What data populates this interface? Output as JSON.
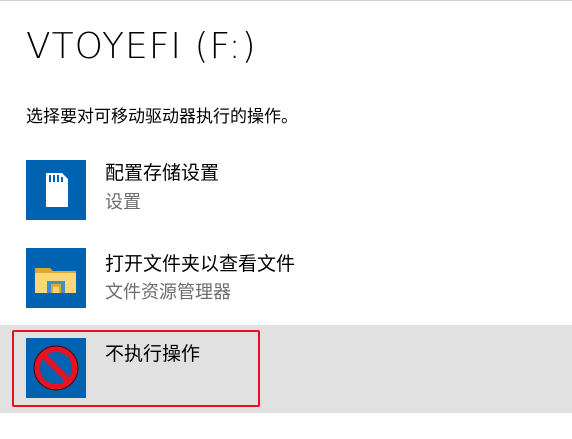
{
  "dialog": {
    "drive_title": "VTOYEFI (F:)",
    "prompt": "选择要对可移动驱动器执行的操作。"
  },
  "options": [
    {
      "title": "配置存储设置",
      "subtitle": "设置",
      "icon": "sd-card-icon",
      "selected": false
    },
    {
      "title": "打开文件夹以查看文件",
      "subtitle": "文件资源管理器",
      "icon": "folder-explorer-icon",
      "selected": false
    },
    {
      "title": "不执行操作",
      "subtitle": "",
      "icon": "no-action-icon",
      "selected": true
    }
  ],
  "colors": {
    "icon_tile": "#0063b1",
    "selected_background": "#e1e1e1",
    "highlight_border": "#e81123",
    "subtitle_text": "#6d6d6d"
  }
}
